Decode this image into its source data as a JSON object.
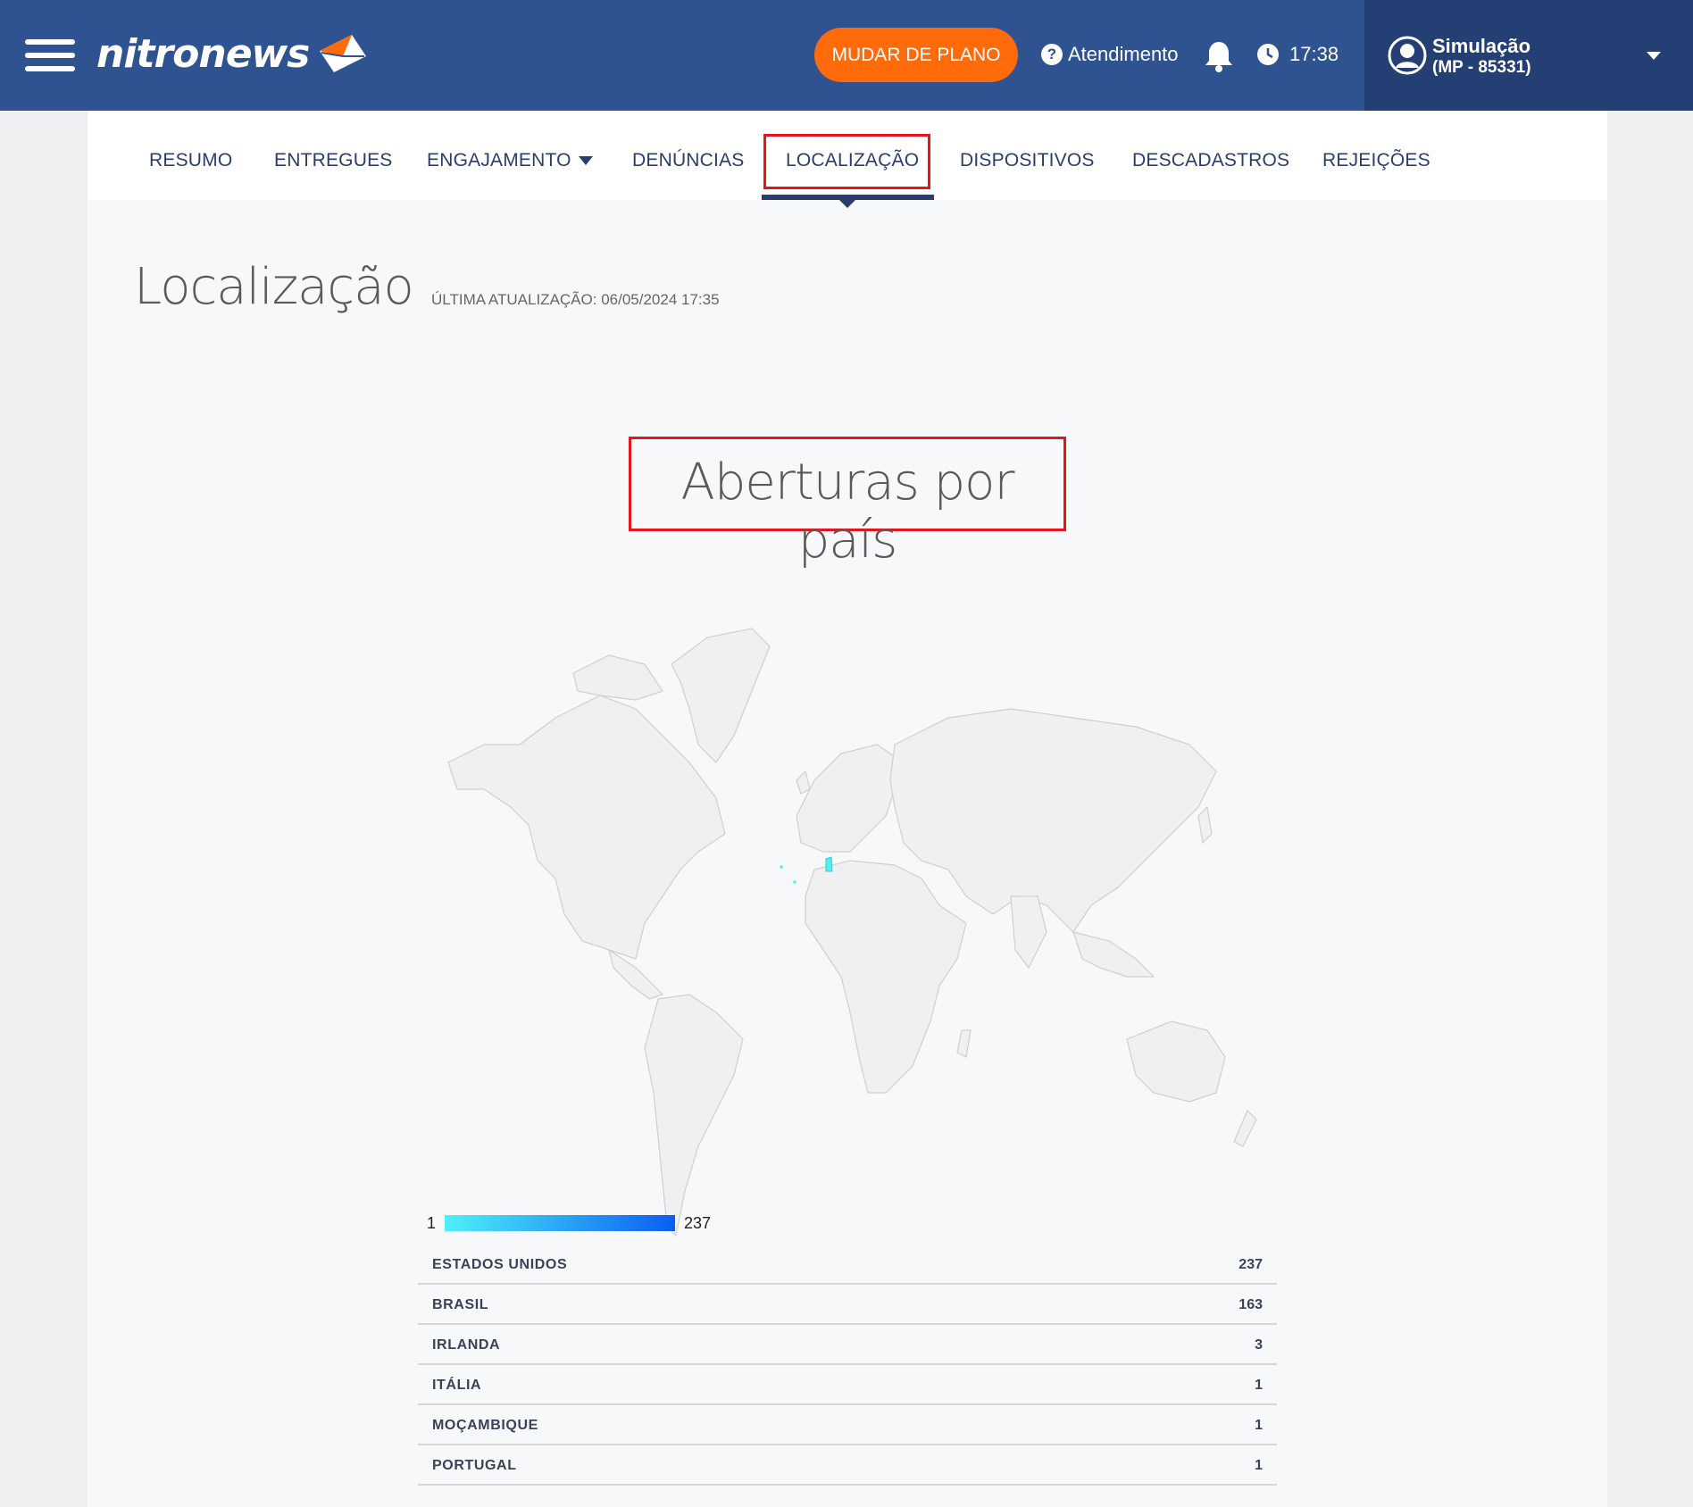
{
  "header": {
    "logo_text": "nitronews",
    "plan_button": "MUDAR DE PLANO",
    "help_label": "Atendimento",
    "time": "17:38",
    "user_name": "Simulação",
    "user_account": "(MP - 85331)"
  },
  "tabs": [
    {
      "label": "RESUMO"
    },
    {
      "label": "ENTREGUES"
    },
    {
      "label": "ENGAJAMENTO"
    },
    {
      "label": "DENÚNCIAS"
    },
    {
      "label": "LOCALIZAÇÃO",
      "active": true
    },
    {
      "label": "DISPOSITIVOS"
    },
    {
      "label": "DESCADASTROS"
    },
    {
      "label": "REJEIÇÕES"
    }
  ],
  "page": {
    "title": "Localização",
    "updated": "ÚLTIMA ATUALIZAÇÃO: 06/05/2024 17:35"
  },
  "chart_data": {
    "type": "table",
    "title": "Aberturas por país",
    "legend_min": "1",
    "legend_max": "237",
    "rows": [
      {
        "country": "ESTADOS UNIDOS",
        "value": 237
      },
      {
        "country": "BRASIL",
        "value": 163
      },
      {
        "country": "IRLANDA",
        "value": 3
      },
      {
        "country": "ITÁLIA",
        "value": 1
      },
      {
        "country": "MOÇAMBIQUE",
        "value": 1
      },
      {
        "country": "PORTUGAL",
        "value": 1
      }
    ]
  },
  "colors": {
    "header_bg": "#2f5291",
    "accent": "#ff6a0a",
    "highlight": "#e3161e",
    "scale_low": "#4ef0f8",
    "scale_high": "#0a5ef0"
  }
}
